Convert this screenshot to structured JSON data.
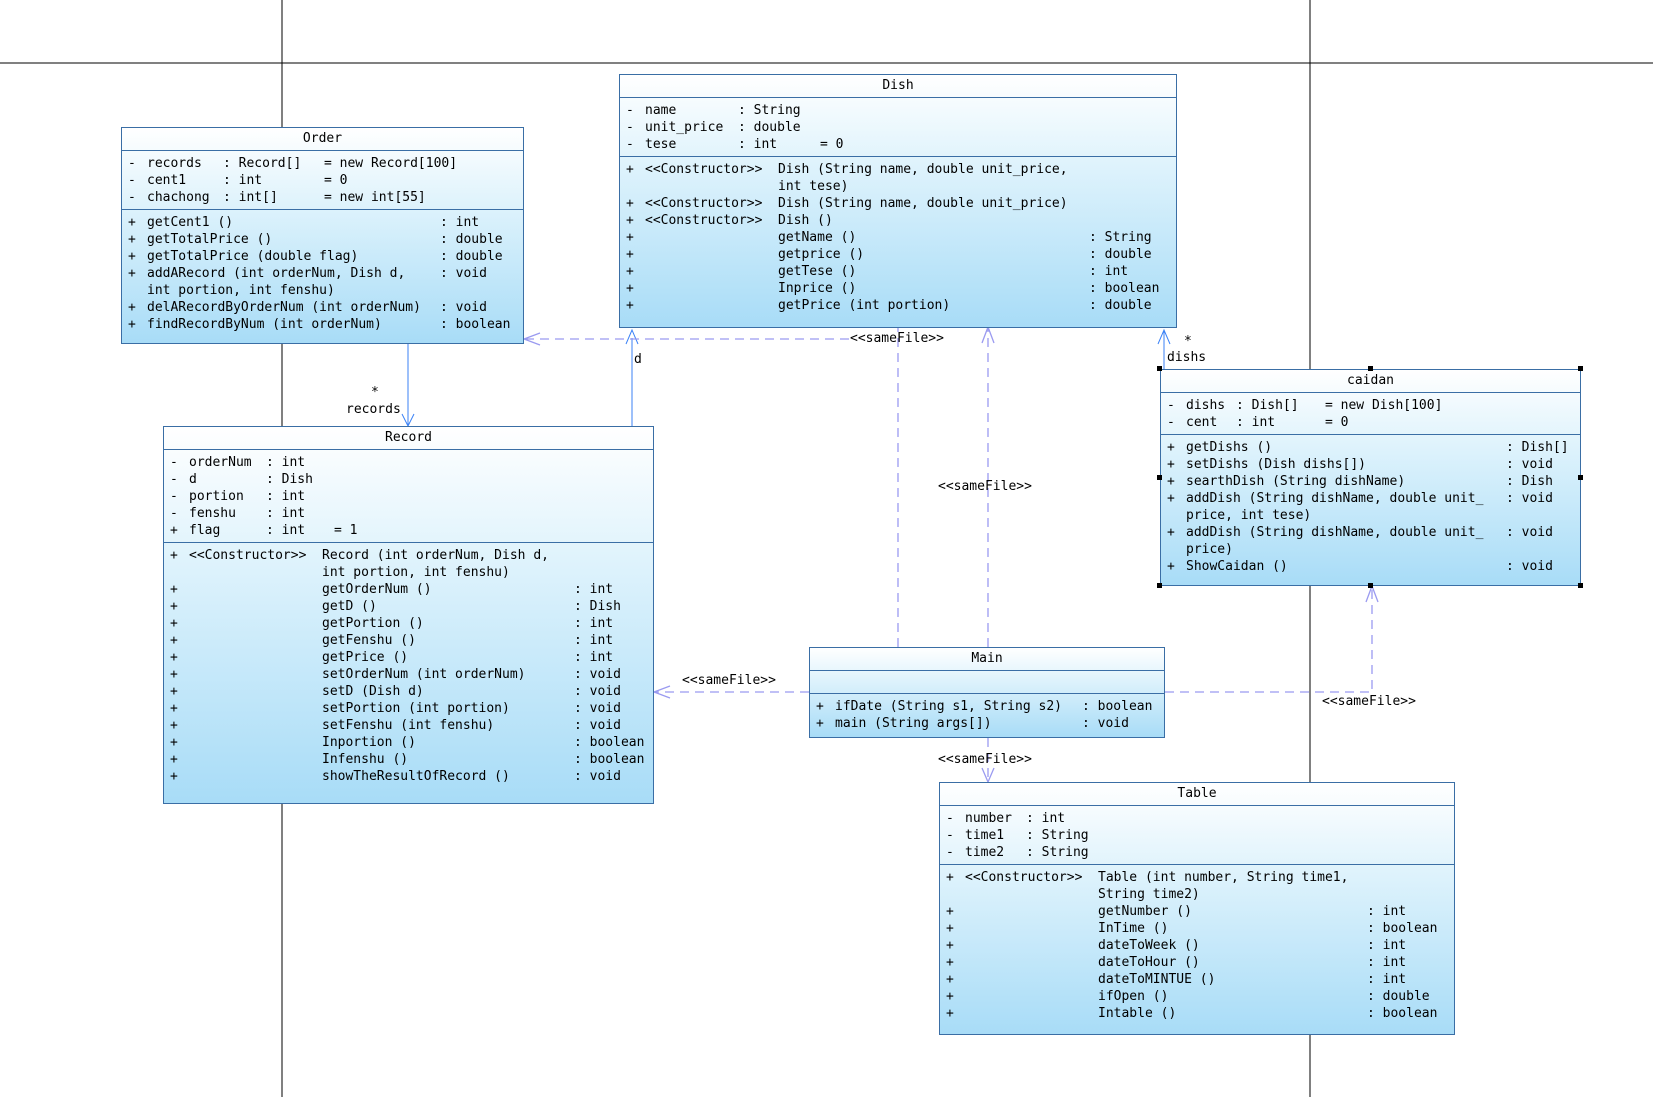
{
  "classes": {
    "order": {
      "name": "Order",
      "attributes": [
        {
          "vis": "-",
          "name": "records",
          "type": ": Record[]",
          "init": "= new Record[100]"
        },
        {
          "vis": "-",
          "name": "cent1",
          "type": ": int",
          "init": "= 0"
        },
        {
          "vis": "-",
          "name": "chachong",
          "type": ": int[]",
          "init": "= new int[55]"
        }
      ],
      "methods": [
        {
          "vis": "+",
          "sig": "getCent1 ()",
          "ret": ": int"
        },
        {
          "vis": "+",
          "sig": "getTotalPrice ()",
          "ret": ": double"
        },
        {
          "vis": "+",
          "sig": "getTotalPrice (double flag)",
          "ret": ": double"
        },
        {
          "vis": "+",
          "sig": "addARecord (int orderNum, Dish d,\n int portion, int fenshu)",
          "ret": ": void"
        },
        {
          "vis": "+",
          "sig": "delARecordByOrderNum (int orderNum)",
          "ret": ": void"
        },
        {
          "vis": "+",
          "sig": "findRecordByNum (int orderNum)",
          "ret": ": boolean"
        }
      ]
    },
    "dish": {
      "name": "Dish",
      "attributes": [
        {
          "vis": "-",
          "name": "name",
          "type": ": String",
          "init": ""
        },
        {
          "vis": "-",
          "name": "unit_price",
          "type": ": double",
          "init": ""
        },
        {
          "vis": "-",
          "name": "tese",
          "type": ": int",
          "init": "= 0"
        }
      ],
      "methods": [
        {
          "vis": "+",
          "stereo": "<<Constructor>>",
          "sig": "Dish (String name, double unit_price,\n int tese)",
          "ret": ""
        },
        {
          "vis": "+",
          "stereo": "<<Constructor>>",
          "sig": "Dish (String name, double unit_price)",
          "ret": ""
        },
        {
          "vis": "+",
          "stereo": "<<Constructor>>",
          "sig": "Dish ()",
          "ret": ""
        },
        {
          "vis": "+",
          "stereo": "",
          "sig": "getName ()",
          "ret": ": String"
        },
        {
          "vis": "+",
          "stereo": "",
          "sig": "getprice ()",
          "ret": ": double"
        },
        {
          "vis": "+",
          "stereo": "",
          "sig": "getTese ()",
          "ret": ": int"
        },
        {
          "vis": "+",
          "stereo": "",
          "sig": "Inprice ()",
          "ret": ": boolean"
        },
        {
          "vis": "+",
          "stereo": "",
          "sig": "getPrice (int portion)",
          "ret": ": double"
        }
      ]
    },
    "record": {
      "name": "Record",
      "attributes": [
        {
          "vis": "-",
          "name": "orderNum",
          "type": ": int",
          "init": ""
        },
        {
          "vis": "-",
          "name": "d",
          "type": ": Dish",
          "init": ""
        },
        {
          "vis": "-",
          "name": "portion",
          "type": ": int",
          "init": ""
        },
        {
          "vis": "-",
          "name": "fenshu",
          "type": ": int",
          "init": ""
        },
        {
          "vis": "+",
          "name": "flag",
          "type": ": int",
          "init": "= 1"
        }
      ],
      "methods": [
        {
          "vis": "+",
          "stereo": "<<Constructor>>",
          "sig": "Record (int orderNum, Dish d,\n int portion, int fenshu)",
          "ret": ""
        },
        {
          "vis": "+",
          "stereo": "",
          "sig": "getOrderNum ()",
          "ret": ": int"
        },
        {
          "vis": "+",
          "stereo": "",
          "sig": "getD ()",
          "ret": ": Dish"
        },
        {
          "vis": "+",
          "stereo": "",
          "sig": "getPortion ()",
          "ret": ": int"
        },
        {
          "vis": "+",
          "stereo": "",
          "sig": "getFenshu ()",
          "ret": ": int"
        },
        {
          "vis": "+",
          "stereo": "",
          "sig": "getPrice ()",
          "ret": ": int"
        },
        {
          "vis": "+",
          "stereo": "",
          "sig": "setOrderNum (int orderNum)",
          "ret": ": void"
        },
        {
          "vis": "+",
          "stereo": "",
          "sig": "setD (Dish d)",
          "ret": ": void"
        },
        {
          "vis": "+",
          "stereo": "",
          "sig": "setPortion (int portion)",
          "ret": ": void"
        },
        {
          "vis": "+",
          "stereo": "",
          "sig": "setFenshu (int fenshu)",
          "ret": ": void"
        },
        {
          "vis": "+",
          "stereo": "",
          "sig": "Inportion ()",
          "ret": ": boolean"
        },
        {
          "vis": "+",
          "stereo": "",
          "sig": "Infenshu ()",
          "ret": ": boolean"
        },
        {
          "vis": "+",
          "stereo": "",
          "sig": "showTheResultOfRecord ()",
          "ret": ": void"
        }
      ]
    },
    "caidan": {
      "name": "caidan",
      "attributes": [
        {
          "vis": "-",
          "name": "dishs",
          "type": ": Dish[]",
          "init": "= new Dish[100]"
        },
        {
          "vis": "-",
          "name": "cent",
          "type": ": int",
          "init": "= 0"
        }
      ],
      "methods": [
        {
          "vis": "+",
          "sig": "getDishs ()",
          "ret": ": Dish[]"
        },
        {
          "vis": "+",
          "sig": "setDishs (Dish dishs[])",
          "ret": ": void"
        },
        {
          "vis": "+",
          "sig": "searthDish (String dishName)",
          "ret": ": Dish"
        },
        {
          "vis": "+",
          "sig": "addDish (String dishName, double unit_\nprice, int tese)",
          "ret": ": void"
        },
        {
          "vis": "+",
          "sig": "addDish (String dishName, double unit_\nprice)",
          "ret": ": void"
        },
        {
          "vis": "+",
          "sig": "ShowCaidan ()",
          "ret": ": void"
        }
      ]
    },
    "main": {
      "name": "Main",
      "methods": [
        {
          "vis": "+",
          "sig": "ifDate (String s1, String s2)",
          "ret": ": boolean"
        },
        {
          "vis": "+",
          "sig": "main (String args[])",
          "ret": ": void"
        }
      ]
    },
    "table": {
      "name": "Table",
      "attributes": [
        {
          "vis": "-",
          "name": "number",
          "type": ": int",
          "init": ""
        },
        {
          "vis": "-",
          "name": "time1",
          "type": ": String",
          "init": ""
        },
        {
          "vis": "-",
          "name": "time2",
          "type": ": String",
          "init": ""
        }
      ],
      "methods": [
        {
          "vis": "+",
          "stereo": "<<Constructor>>",
          "sig": "Table (int number, String time1,\n String time2)",
          "ret": ""
        },
        {
          "vis": "+",
          "stereo": "",
          "sig": "getNumber ()",
          "ret": ": int"
        },
        {
          "vis": "+",
          "stereo": "",
          "sig": "InTime ()",
          "ret": ": boolean"
        },
        {
          "vis": "+",
          "stereo": "",
          "sig": "dateToWeek ()",
          "ret": ": int"
        },
        {
          "vis": "+",
          "stereo": "",
          "sig": "dateToHour ()",
          "ret": ": int"
        },
        {
          "vis": "+",
          "stereo": "",
          "sig": "dateToMINTUE ()",
          "ret": ": int"
        },
        {
          "vis": "+",
          "stereo": "",
          "sig": "ifOpen ()",
          "ret": ": double"
        },
        {
          "vis": "+",
          "stereo": "",
          "sig": "Intable ()",
          "ret": ": boolean"
        }
      ]
    }
  },
  "labels": {
    "records_mult": "*",
    "records_role": "records",
    "d_role": "d",
    "dishs_mult": "*",
    "dishs_role": "dishs",
    "samefile_dish_order": "<<sameFile>>",
    "samefile_main_dish": "<<sameFile>>",
    "samefile_main_record": "<<sameFile>>",
    "samefile_main_table": "<<sameFile>>",
    "samefile_main_caidan": "<<sameFile>>"
  },
  "colors": {
    "class_border": "#3a6ea5",
    "association_line": "#3b82f6",
    "dependency_line": "#9a9af0",
    "frame_line": "#000000"
  }
}
